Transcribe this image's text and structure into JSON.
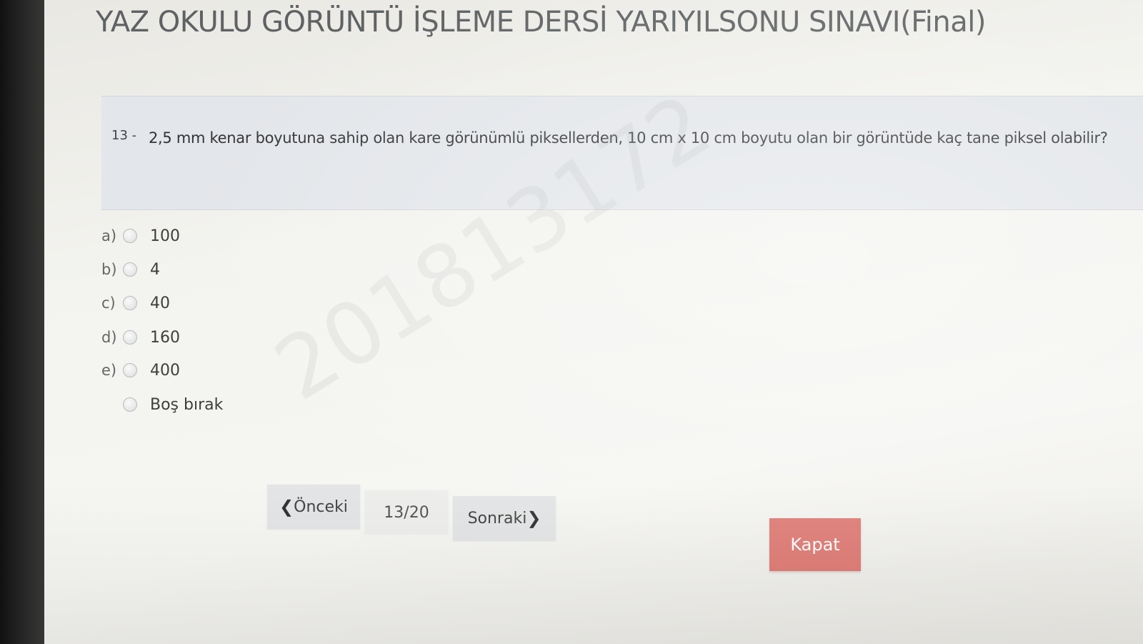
{
  "exam": {
    "title": "YAZ OKULU GÖRÜNTÜ İŞLEME DERSİ YARIYILSONU SINAVI(Final)"
  },
  "question": {
    "number": "13 -",
    "text": "2,5 mm kenar boyutuna sahip olan kare görünümlü piksellerden, 10 cm x 10 cm boyutu olan bir görüntüde kaç tane piksel olabilir?"
  },
  "watermark": "201813172",
  "options": [
    {
      "letter": "a)",
      "value": "100"
    },
    {
      "letter": "b)",
      "value": "4"
    },
    {
      "letter": "c)",
      "value": "40"
    },
    {
      "letter": "d)",
      "value": "160"
    },
    {
      "letter": "e)",
      "value": "400"
    },
    {
      "letter": "",
      "value": "Boş bırak"
    }
  ],
  "navigation": {
    "prev_label": "Önceki",
    "page_indicator": "13/20",
    "next_label": "Sonraki",
    "close_label": "Kapat"
  },
  "colors": {
    "close_button": "#e07c76",
    "question_box": "#e3e6ea"
  }
}
